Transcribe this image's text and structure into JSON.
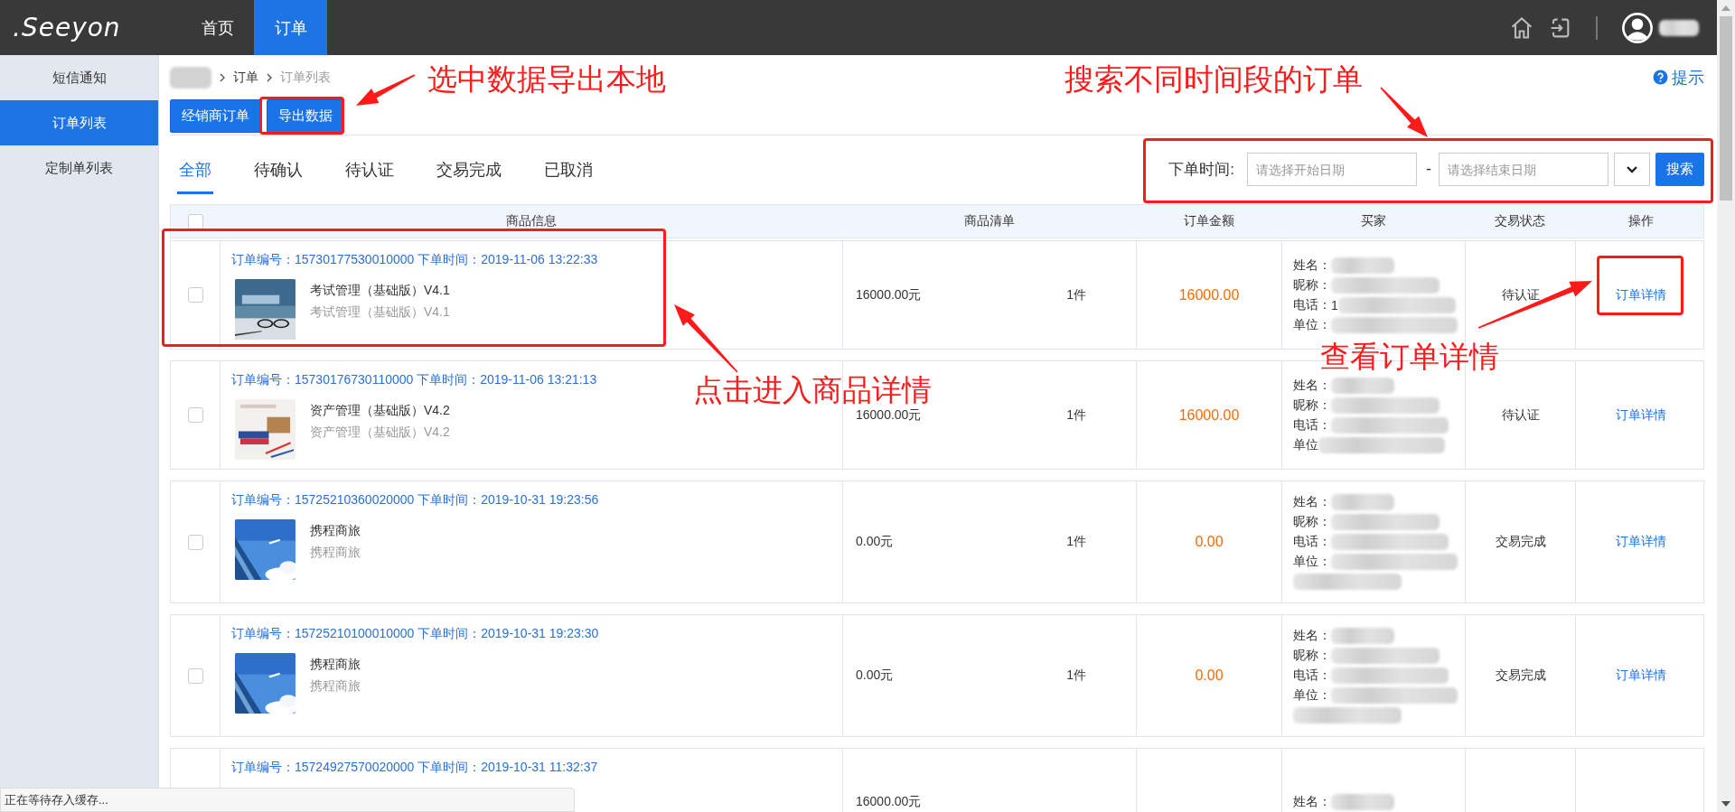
{
  "header": {
    "logo": ".Seeyon",
    "nav": [
      {
        "label": "首页",
        "selected": false
      },
      {
        "label": "订单",
        "selected": true
      }
    ]
  },
  "sidebar": {
    "items": [
      {
        "label": "短信通知",
        "selected": false
      },
      {
        "label": "订单列表",
        "selected": true
      },
      {
        "label": "定制单列表",
        "selected": false
      }
    ]
  },
  "breadcrumb": [
    {
      "label": "订单",
      "current": false
    },
    {
      "label": "订单列表",
      "current": true
    }
  ],
  "actions": [
    {
      "label": "经销商订单"
    },
    {
      "label": "导出数据"
    }
  ],
  "help": {
    "label": "提示"
  },
  "tabs": [
    {
      "label": "全部",
      "selected": true
    },
    {
      "label": "待确认",
      "selected": false
    },
    {
      "label": "待认证",
      "selected": false
    },
    {
      "label": "交易完成",
      "selected": false
    },
    {
      "label": "已取消",
      "selected": false
    }
  ],
  "search": {
    "label": "下单时间:",
    "start": {
      "placeholder": "请选择开始日期"
    },
    "separator": "-",
    "end": {
      "placeholder": "请选择结束日期"
    },
    "button": "搜索"
  },
  "table": {
    "select_all": {
      "checked": false
    },
    "columns": [
      "商品信息",
      "商品清单",
      "订单金额",
      "买家",
      "交易状态",
      "操作"
    ],
    "rows": [
      {
        "checked": false,
        "order_line": "订单编号：15730177530010000 下单时间：2019-11-06 13:22:33",
        "product": {
          "name": "考试管理（基础版）V4.1",
          "subtitle": "考试管理（基础版）V4.1"
        },
        "price": "16000.00元",
        "quantity": "1件",
        "amount": "16000.00",
        "buyer": [
          {
            "label": "姓名："
          },
          {
            "label": "昵称："
          },
          {
            "label": "电话：",
            "value": "1"
          },
          {
            "label": "单位："
          }
        ],
        "buyer_unit_wrapped": false,
        "status": "待认证",
        "action": "订单详情"
      },
      {
        "checked": false,
        "order_line": "订单编号：15730176730110000 下单时间：2019-11-06 13:21:13",
        "product": {
          "name": "资产管理（基础版）V4.2",
          "subtitle": "资产管理（基础版）V4.2"
        },
        "price": "16000.00元",
        "quantity": "1件",
        "amount": "16000.00",
        "buyer": [
          {
            "label": "姓名："
          },
          {
            "label": "昵称："
          },
          {
            "label": "电话："
          },
          {
            "label": "单位"
          }
        ],
        "buyer_unit_wrapped": false,
        "status": "待认证",
        "action": "订单详情"
      },
      {
        "checked": false,
        "order_line": "订单编号：15725210360020000 下单时间：2019-10-31 19:23:56",
        "product": {
          "name": "携程商旅",
          "subtitle": "携程商旅"
        },
        "price": "0.00元",
        "quantity": "1件",
        "amount": "0.00",
        "buyer": [
          {
            "label": "姓名："
          },
          {
            "label": "昵称："
          },
          {
            "label": "电话："
          },
          {
            "label": "单位："
          }
        ],
        "buyer_unit_wrapped": true,
        "status": "交易完成",
        "action": "订单详情"
      },
      {
        "checked": false,
        "order_line": "订单编号：15725210100010000 下单时间：2019-10-31 19:23:30",
        "product": {
          "name": "携程商旅",
          "subtitle": "携程商旅"
        },
        "price": "0.00元",
        "quantity": "1件",
        "amount": "0.00",
        "buyer": [
          {
            "label": "姓名："
          },
          {
            "label": "昵称："
          },
          {
            "label": "电话："
          },
          {
            "label": "单位："
          }
        ],
        "buyer_unit_wrapped": true,
        "status": "交易完成",
        "action": "订单详情"
      },
      {
        "order_line": "订单编号：15724927570020000 下单时间：2019-10-31 11:32:37",
        "price": "16000.00元",
        "buyer": [
          {
            "label": "姓名："
          }
        ],
        "buyer_unit_wrapped": false
      }
    ]
  },
  "annotations": [
    {
      "text": "选中数据导出本地"
    },
    {
      "text": "搜索不同时间段的订单"
    },
    {
      "text": "点击进入商品详情"
    },
    {
      "text": "查看订单详情"
    }
  ],
  "status_bar": {
    "text": "正在等待存入缓存..."
  }
}
